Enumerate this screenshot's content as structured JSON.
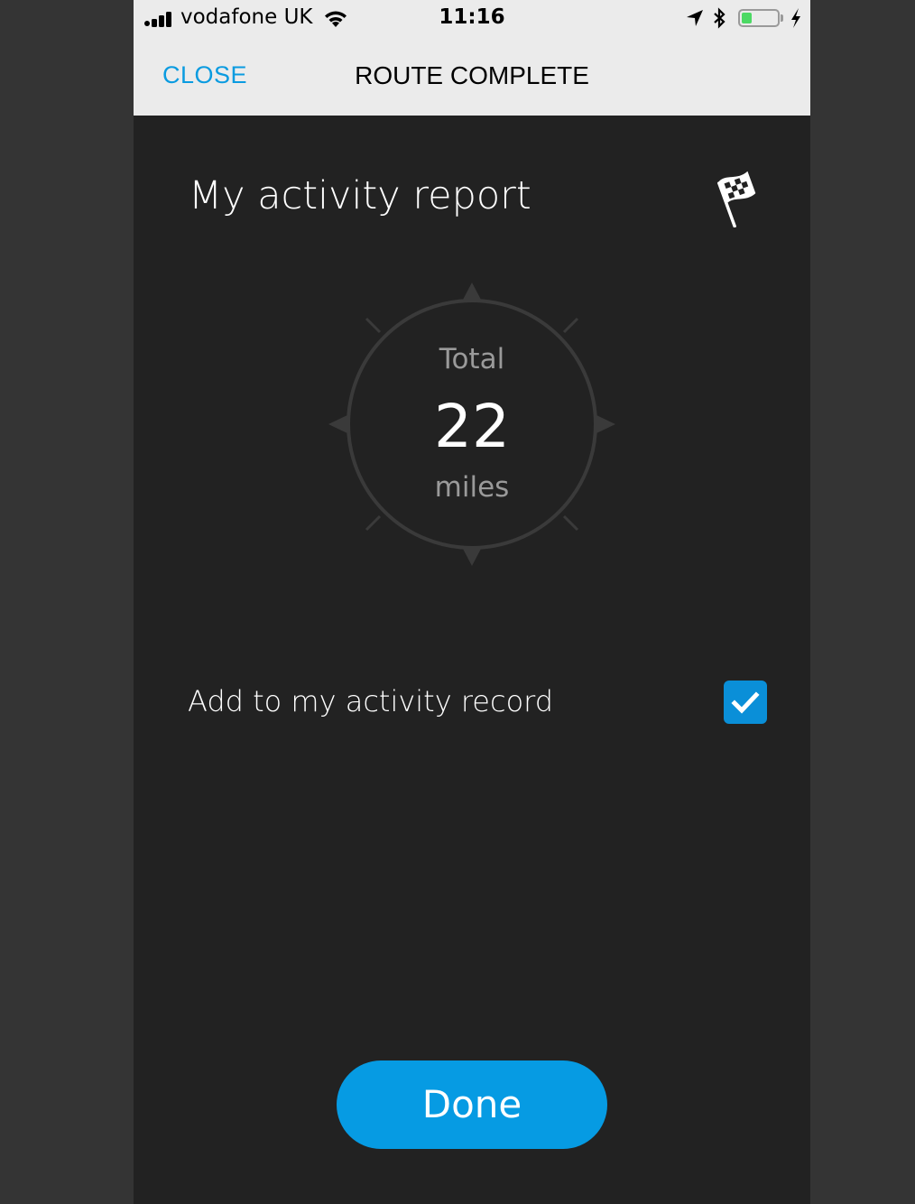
{
  "status_bar": {
    "carrier": "vodafone UK",
    "time": "11:16",
    "signal_icon": "signal-bars-icon",
    "wifi_icon": "wifi-icon",
    "location_icon": "location-arrow-icon",
    "bluetooth_icon": "bluetooth-icon",
    "battery_level": 0.3,
    "battery_color": "#4cd964",
    "charging_icon": "charging-bolt-icon"
  },
  "nav": {
    "close_label": "CLOSE",
    "title": "ROUTE COMPLETE",
    "accent_color": "#0a9be0"
  },
  "report": {
    "title": "My activity report",
    "icon": "checkered-flag-icon",
    "total_label": "Total",
    "total_value": "22",
    "total_unit": "miles"
  },
  "record": {
    "label": "Add to my activity record",
    "checked": true
  },
  "actions": {
    "done_label": "Done",
    "done_color": "#069be3"
  }
}
